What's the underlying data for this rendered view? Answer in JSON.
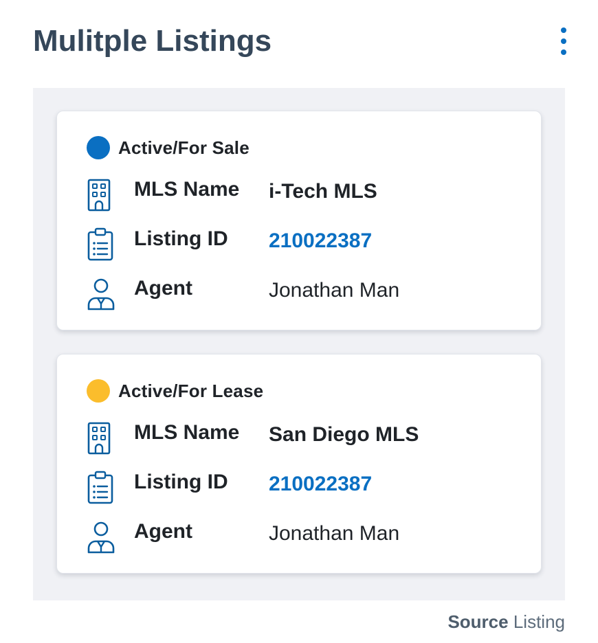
{
  "header": {
    "title": "Mulitple Listings",
    "menu_icon": "more-vertical-icon"
  },
  "listings": [
    {
      "status": "Active/For Sale",
      "status_color": "#0a6fc2",
      "mls_label": "MLS Name",
      "mls_value": "i-Tech MLS",
      "listing_id_label": "Listing ID",
      "listing_id_value": "210022387",
      "agent_label": "Agent",
      "agent_value": "Jonathan Man"
    },
    {
      "status": "Active/For Lease",
      "status_color": "#fbbd2c",
      "mls_label": "MLS Name",
      "mls_value": "San Diego MLS",
      "listing_id_label": "Listing ID",
      "listing_id_value": "210022387",
      "agent_label": "Agent",
      "agent_value": "Jonathan Man"
    }
  ],
  "icons": {
    "mls": "building-icon",
    "listing_id": "clipboard-list-icon",
    "agent": "agent-person-icon"
  },
  "footer": {
    "source_key": "Source",
    "source_value": "Listing"
  },
  "colors": {
    "title": "#35475a",
    "accent": "#0a6fc2",
    "panel_bg": "#f0f1f5",
    "icon": "#0a5d9e"
  }
}
